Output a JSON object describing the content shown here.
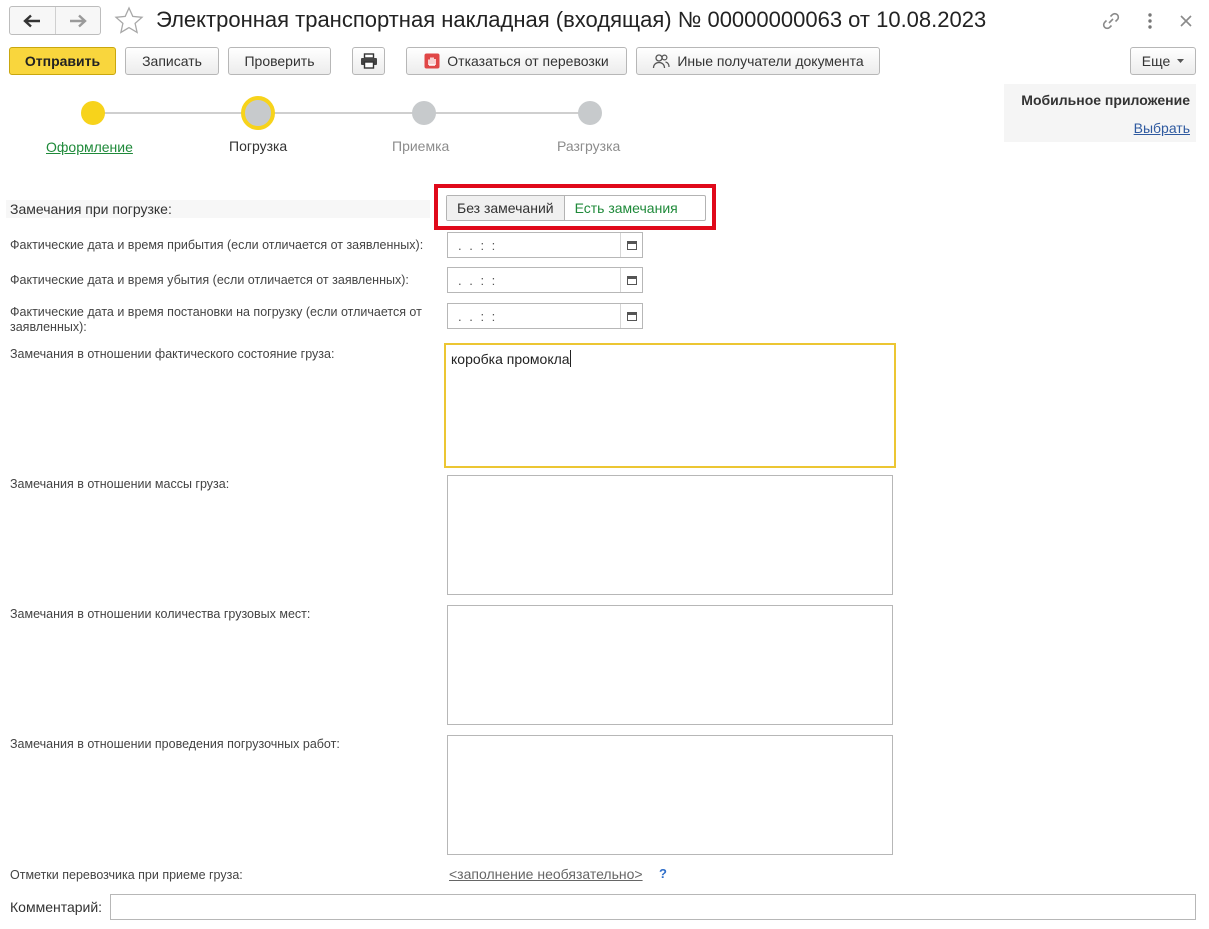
{
  "window": {
    "title": "Электронная транспортная накладная (входящая) № 00000000063 от 10.08.2023"
  },
  "toolbar": {
    "send": "Отправить",
    "save": "Записать",
    "check": "Проверить",
    "refuse": "Отказаться от перевозки",
    "other_recipients": "Иные получатели документа",
    "more": "Еще"
  },
  "mobile": {
    "title": "Мобильное приложение",
    "link": "Выбрать"
  },
  "steps": [
    {
      "label": "Оформление",
      "state": "done"
    },
    {
      "label": "Погрузка",
      "state": "current"
    },
    {
      "label": "Приемка",
      "state": "pending"
    },
    {
      "label": "Разгрузка",
      "state": "pending"
    }
  ],
  "form": {
    "remarks_label": "Замечания при погрузке:",
    "remarks_options": [
      "Без замечаний",
      "Есть замечания"
    ],
    "remarks_selected": "Есть замечания",
    "arrival_label": "Фактические дата и время прибытия (если отличается от заявленных):",
    "departure_label": "Фактические дата и время убытия (если отличается от заявленных):",
    "loading_label": "Фактические дата и время постановки на погрузку (если отличается от заявленных):",
    "date_placeholder": " .  .      :  :",
    "state_label": "Замечания в отношении фактического состояние груза:",
    "state_value": "коробка промокла",
    "mass_label": "Замечания в отношении массы груза:",
    "mass_value": "",
    "places_label": "Замечания в отношении количества грузовых мест:",
    "places_value": "",
    "works_label": "Замечания в отношении проведения погрузочных работ:",
    "works_value": "",
    "carrier_label": "Отметки перевозчика при приеме груза:",
    "carrier_link": "<заполнение необязательно>",
    "help": "?",
    "comment_label": "Комментарий:",
    "comment_value": ""
  },
  "colors": {
    "accent_yellow": "#f7d31b",
    "highlight_red": "#e0091a",
    "selected_green": "#1f8a3a",
    "link_blue": "#2f5aa0"
  },
  "icons": [
    "arrow-left-icon",
    "arrow-right-icon",
    "star-icon",
    "link-icon",
    "more-vertical-icon",
    "close-icon",
    "print-icon",
    "stop-hand-icon",
    "users-icon",
    "calendar-icon",
    "dropdown-icon"
  ]
}
